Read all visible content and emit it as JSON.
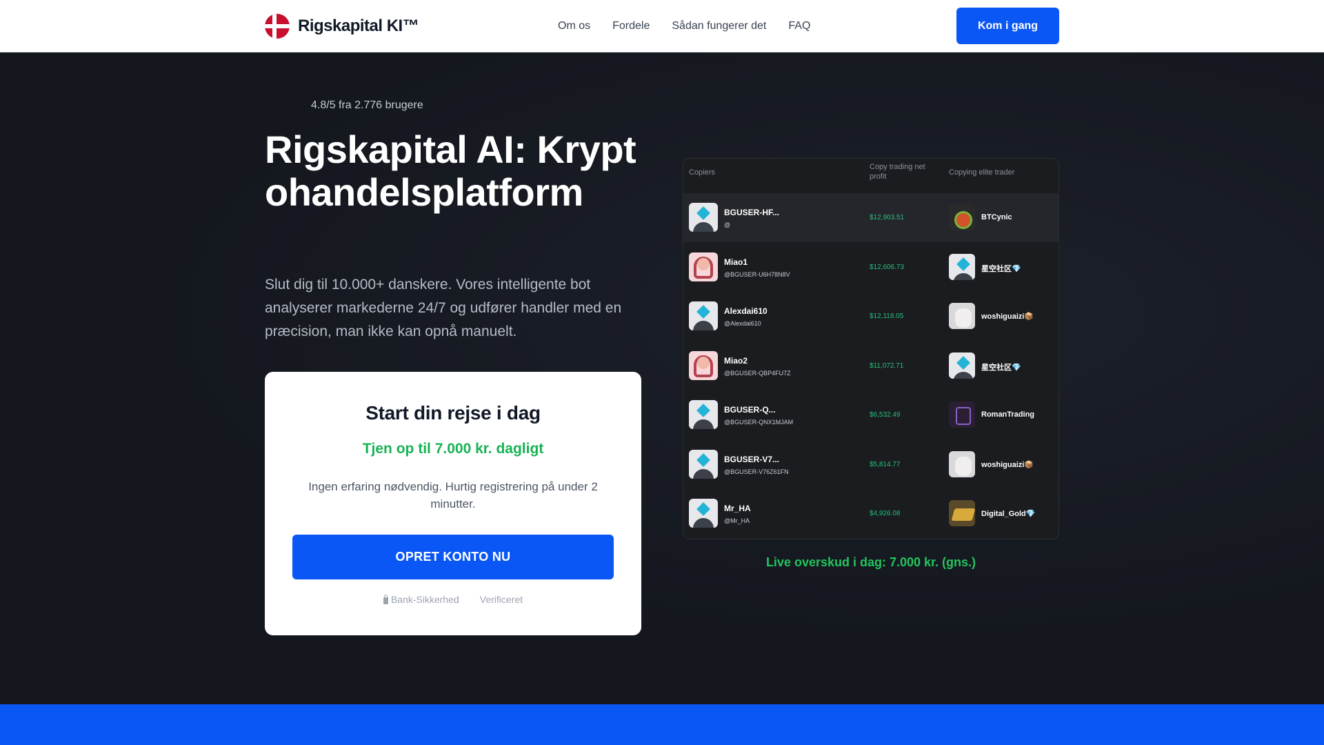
{
  "header": {
    "brand": "Rigskapital KI™",
    "nav": [
      "Om os",
      "Fordele",
      "Sådan fungerer det",
      "FAQ"
    ],
    "cta": "Kom i gang"
  },
  "hero": {
    "rating": "4.8/5 fra 2.776 brugere",
    "title": "Rigskapital AI: Kryptohandelsplatform",
    "subtitle": "Slut dig til 10.000+ danskere. Vores intelligente bot analyserer markederne 24/7 og udfører handler med en præcision, man ikke kan opnå manuelt."
  },
  "signup": {
    "title": "Start din rejse i dag",
    "earn": "Tjen op til 7.000 kr. dagligt",
    "desc": "Ingen erfaring nødvendig. Hurtig registrering på under 2 minutter.",
    "button": "OPRET KONTO NU",
    "trust": [
      "Bank-Sikkerhed",
      "Verificeret"
    ]
  },
  "table": {
    "headers": [
      "Copiers",
      "Copy trading net profit",
      "Copying elite trader"
    ],
    "rows": [
      {
        "name": "BGUSER-HF...",
        "handle": "@",
        "profit": "$12,903.51",
        "trader": "BTCynic",
        "avatar": "default",
        "trader_avatar": "btc"
      },
      {
        "name": "Miao1",
        "handle": "@BGUSER-U6H78N8V",
        "profit": "$12,606.73",
        "trader": "星空社区💎",
        "avatar": "pink",
        "trader_avatar": "default"
      },
      {
        "name": "Alexdai610",
        "handle": "@Alexdai610",
        "profit": "$12,118.05",
        "trader": "woshiguaizi📦",
        "avatar": "default",
        "trader_avatar": "cat"
      },
      {
        "name": "Miao2",
        "handle": "@BGUSER-QBP4FU7Z",
        "profit": "$11,072.71",
        "trader": "星空社区💎",
        "avatar": "pink",
        "trader_avatar": "default"
      },
      {
        "name": "BGUSER-Q...",
        "handle": "@BGUSER-QNX1MJAM",
        "profit": "$6,532.49",
        "trader": "RomanTrading",
        "avatar": "default",
        "trader_avatar": "dark"
      },
      {
        "name": "BGUSER-V7...",
        "handle": "@BGUSER-V76Z61FN",
        "profit": "$5,814.77",
        "trader": "woshiguaizi📦",
        "avatar": "default",
        "trader_avatar": "cat"
      },
      {
        "name": "Mr_HA",
        "handle": "@Mr_HA",
        "profit": "$4,926.08",
        "trader": "Digital_Gold💎",
        "avatar": "default",
        "trader_avatar": "gold"
      }
    ]
  },
  "live": "Live overskud i dag: 7.000 kr. (gns.)",
  "colors": {
    "accent": "#0b57f5",
    "success": "#16b354",
    "dark_bg": "#14171e"
  }
}
